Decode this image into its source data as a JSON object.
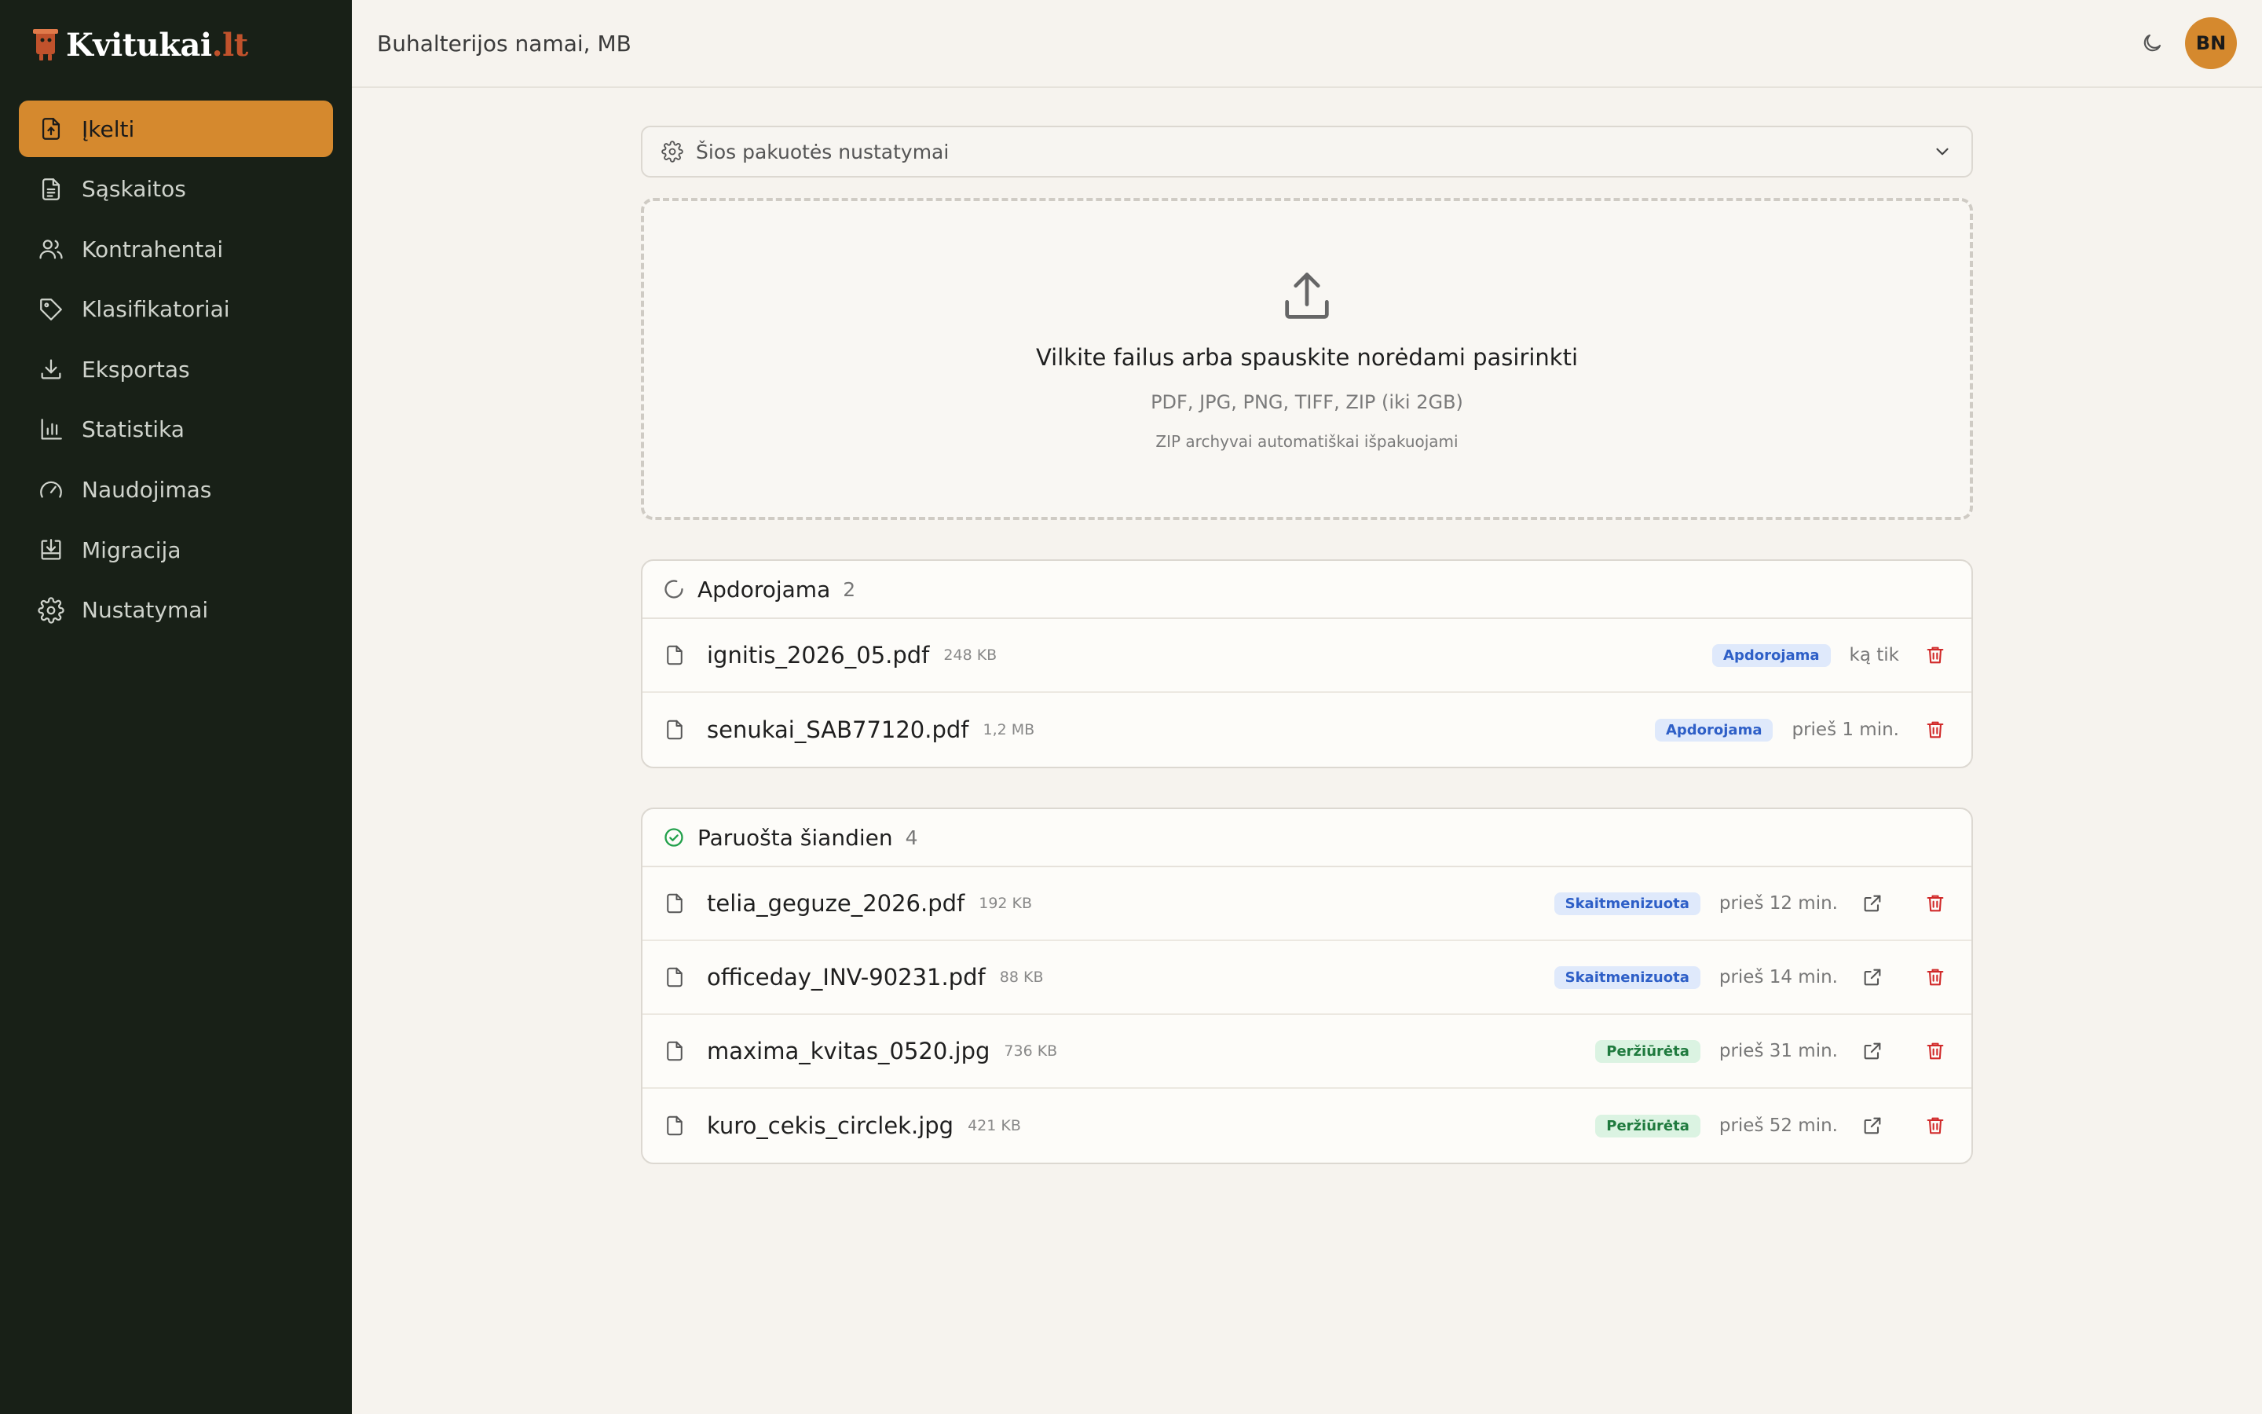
{
  "brand": {
    "name": "Kvitukai",
    "tld": ".lt"
  },
  "header": {
    "org_name": "Buhalterijos namai, MB",
    "avatar_initials": "BN"
  },
  "sidebar": {
    "items": [
      {
        "label": "Įkelti",
        "icon": "upload-file-icon",
        "active": true
      },
      {
        "label": "Sąskaitos",
        "icon": "document-icon"
      },
      {
        "label": "Kontrahentai",
        "icon": "users-icon"
      },
      {
        "label": "Klasifikatoriai",
        "icon": "tag-icon"
      },
      {
        "label": "Eksportas",
        "icon": "download-icon"
      },
      {
        "label": "Statistika",
        "icon": "bar-chart-icon"
      },
      {
        "label": "Naudojimas",
        "icon": "gauge-icon"
      },
      {
        "label": "Migracija",
        "icon": "import-icon"
      },
      {
        "label": "Nustatymai",
        "icon": "gear-icon"
      }
    ]
  },
  "settings": {
    "label": "Šios pakuotės nustatymai"
  },
  "dropzone": {
    "title": "Vilkite failus arba spauskite norėdami pasirinkti",
    "formats": "PDF, JPG, PNG, TIFF, ZIP (iki 2GB)",
    "note": "ZIP archyvai automatiškai išpakuojami"
  },
  "processing": {
    "title": "Apdorojama",
    "count": "2",
    "rows": [
      {
        "name": "ignitis_2026_05.pdf",
        "size": "248 KB",
        "status": "Apdorojama",
        "time": "ką tik"
      },
      {
        "name": "senukai_SAB77120.pdf",
        "size": "1,2 MB",
        "status": "Apdorojama",
        "time": "prieš 1 min."
      }
    ]
  },
  "ready": {
    "title": "Paruošta šiandien",
    "count": "4",
    "rows": [
      {
        "name": "telia_geguze_2026.pdf",
        "size": "192 KB",
        "status": "Skaitmenizuota",
        "time": "prieš 12 min."
      },
      {
        "name": "officeday_INV-90231.pdf",
        "size": "88 KB",
        "status": "Skaitmenizuota",
        "time": "prieš 14 min."
      },
      {
        "name": "maxima_kvitas_0520.jpg",
        "size": "736 KB",
        "status": "Peržiūrėta",
        "time": "prieš 31 min."
      },
      {
        "name": "kuro_cekis_circlek.jpg",
        "size": "421 KB",
        "status": "Peržiūrėta",
        "time": "prieš 52 min."
      }
    ]
  },
  "colors": {
    "sidebar_bg": "#182017",
    "accent": "#d5892e",
    "brand_tld": "#c0522c",
    "badge_blue": "#2e5fc7",
    "badge_green": "#1f7a3e",
    "delete_red": "#d12a2a"
  }
}
